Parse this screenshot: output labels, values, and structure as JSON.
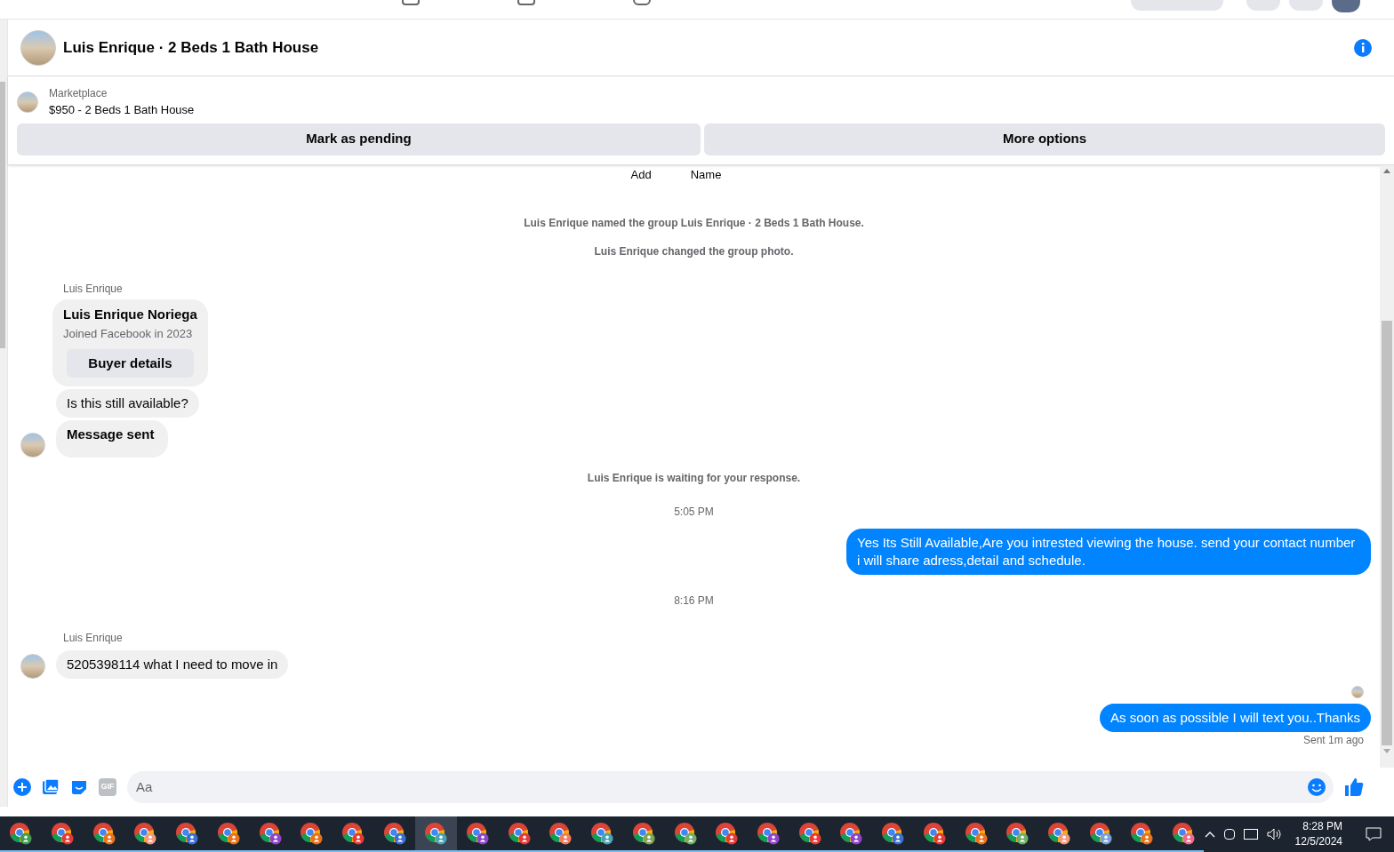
{
  "header": {
    "title": "Luis Enrique · 2 Beds 1 Bath House"
  },
  "listing": {
    "source": "Marketplace",
    "title": "$950 - 2 Beds 1 Bath House",
    "buttons": [
      "Mark as pending",
      "More options"
    ]
  },
  "group_actions": [
    "Add",
    "Name"
  ],
  "messages": [
    {
      "kind": "system",
      "text": "Luis Enrique named the group Luis Enrique · 2 Beds 1 Bath House."
    },
    {
      "kind": "system",
      "text": "Luis Enrique changed the group photo."
    },
    {
      "kind": "sender",
      "text": "Luis Enrique"
    },
    {
      "kind": "profile",
      "name": "Luis Enrique Noriega",
      "detail": "Joined Facebook in 2023",
      "button": "Buyer details"
    },
    {
      "kind": "incoming",
      "text": "Is this still available?",
      "avatar": false,
      "bold": false
    },
    {
      "kind": "incoming",
      "text": "Message sent",
      "avatar": true,
      "bold": true
    },
    {
      "kind": "system",
      "text": "Luis Enrique is waiting for your response."
    },
    {
      "kind": "time",
      "text": "5:05 PM"
    },
    {
      "kind": "outgoing",
      "text": "Yes Its Still Available,Are you intrested viewing the house. send your contact number i will share adress,detail and schedule."
    },
    {
      "kind": "time",
      "text": "8:16 PM"
    },
    {
      "kind": "sender",
      "text": "Luis Enrique"
    },
    {
      "kind": "incoming",
      "text": "5205398114 what I need to move in",
      "avatar": true,
      "bold": false
    },
    {
      "kind": "seen"
    },
    {
      "kind": "outgoing",
      "text": "As soon as possible I will text you..Thanks"
    },
    {
      "kind": "status",
      "text": "Sent 1m ago"
    }
  ],
  "composer": {
    "gif_label": "GIF",
    "placeholder": "Aa"
  },
  "taskbar": {
    "apps": [
      {
        "color": "#3f9b4f",
        "selected": false
      },
      {
        "color": "#e53935",
        "selected": false
      },
      {
        "color": "#e8711a",
        "selected": false
      },
      {
        "color": "#f29b7c",
        "selected": false
      },
      {
        "color": "#3b6fd1",
        "selected": false
      },
      {
        "color": "#e8711a",
        "selected": false
      },
      {
        "color": "#8e44c9",
        "selected": false
      },
      {
        "color": "#e8711a",
        "selected": false
      },
      {
        "color": "#e53935",
        "selected": false
      },
      {
        "color": "#3b6fd1",
        "selected": false
      },
      {
        "color": "#4aa3b5",
        "selected": true
      },
      {
        "color": "#8e44c9",
        "selected": false
      },
      {
        "color": "#e53935",
        "selected": false
      },
      {
        "color": "#f07a5a",
        "selected": false
      },
      {
        "color": "#4aa3b5",
        "selected": false
      },
      {
        "color": "#7fa552",
        "selected": false
      },
      {
        "color": "#6fae6a",
        "selected": false
      },
      {
        "color": "#e53935",
        "selected": false
      },
      {
        "color": "#8e44c9",
        "selected": false
      },
      {
        "color": "#e53935",
        "selected": false
      },
      {
        "color": "#8e44c9",
        "selected": false
      },
      {
        "color": "#3b6fd1",
        "selected": false
      },
      {
        "color": "#e53935",
        "selected": false
      },
      {
        "color": "#e8711a",
        "selected": false
      },
      {
        "color": "#6fae6a",
        "selected": false
      },
      {
        "color": "#f29b7c",
        "selected": false
      },
      {
        "color": "#7aa0d8",
        "selected": false
      },
      {
        "color": "#e8711a",
        "selected": false
      },
      {
        "color": "#f06a8a",
        "selected": false
      }
    ],
    "time": "8:28 PM",
    "date": "12/5/2024"
  }
}
